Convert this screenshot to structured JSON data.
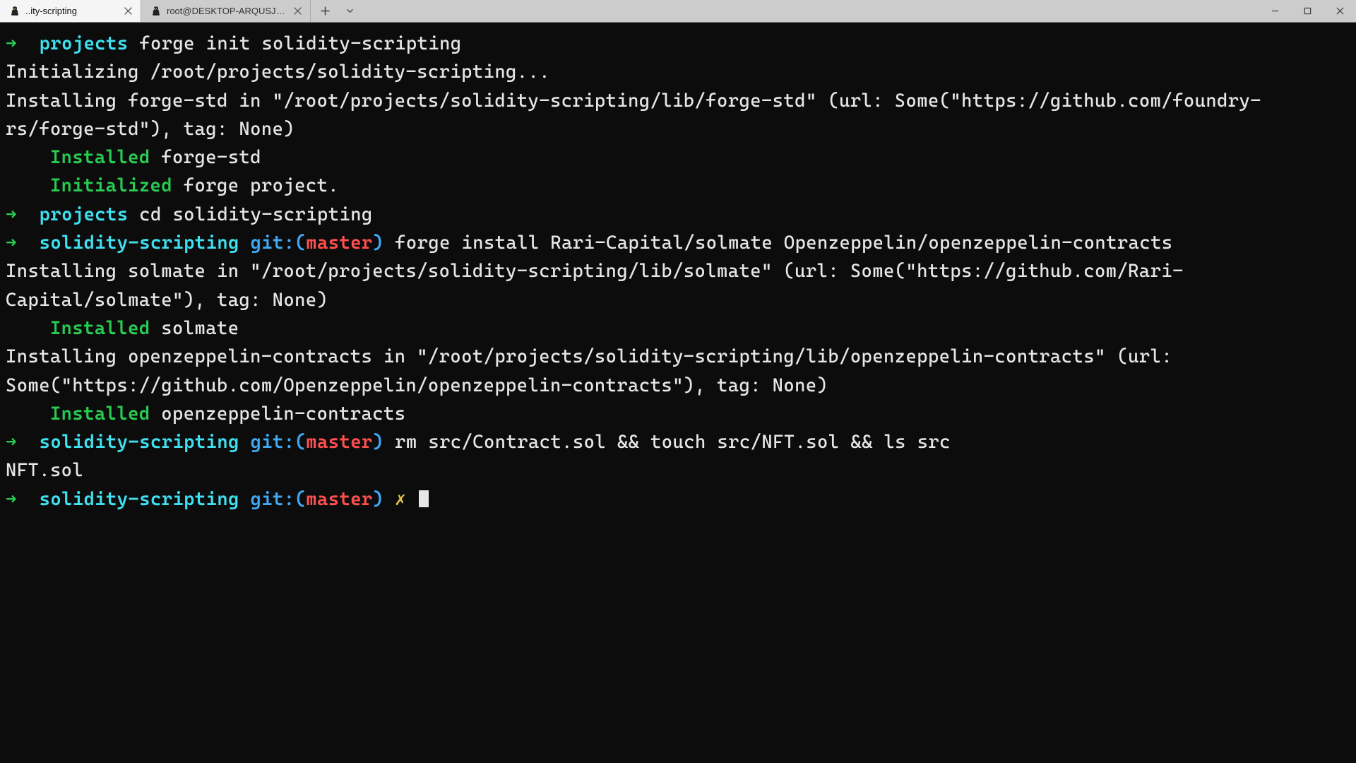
{
  "tabs": [
    {
      "title": "..ity-scripting",
      "active": true
    },
    {
      "title": "root@DESKTOP-ARQUSJA: ~/p",
      "active": false
    }
  ],
  "colors": {
    "arrow": "#29cc52",
    "cyan": "#3fe0ef",
    "blue": "#3fa9f5",
    "red": "#ff4f4f",
    "green": "#29cc52",
    "yellow": "#e6c34a"
  },
  "terminal": {
    "lines": [
      {
        "segments": [
          {
            "class": "c-arrow",
            "text": "➜  "
          },
          {
            "class": "c-cyan",
            "text": "projects"
          },
          {
            "class": "c-plain",
            "text": " forge init solidity-scripting"
          }
        ]
      },
      {
        "segments": [
          {
            "class": "c-plain",
            "text": "Initializing /root/projects/solidity-scripting..."
          }
        ]
      },
      {
        "segments": [
          {
            "class": "c-plain",
            "text": "Installing forge-std in \"/root/projects/solidity-scripting/lib/forge-std\" (url: Some(\"https://github.com/foundry-rs/forge-std\"), tag: None)"
          }
        ]
      },
      {
        "segments": [
          {
            "class": "c-plain",
            "text": "    "
          },
          {
            "class": "c-green",
            "text": "Installed"
          },
          {
            "class": "c-plain",
            "text": " forge-std"
          }
        ]
      },
      {
        "segments": [
          {
            "class": "c-plain",
            "text": "    "
          },
          {
            "class": "c-green",
            "text": "Initialized"
          },
          {
            "class": "c-plain",
            "text": " forge project."
          }
        ]
      },
      {
        "segments": [
          {
            "class": "c-arrow",
            "text": "➜  "
          },
          {
            "class": "c-cyan",
            "text": "projects"
          },
          {
            "class": "c-plain",
            "text": " cd solidity-scripting"
          }
        ]
      },
      {
        "segments": [
          {
            "class": "c-arrow",
            "text": "➜  "
          },
          {
            "class": "c-cyan",
            "text": "solidity-scripting"
          },
          {
            "class": "c-plain",
            "text": " "
          },
          {
            "class": "c-blue",
            "text": "git:("
          },
          {
            "class": "c-red",
            "text": "master"
          },
          {
            "class": "c-blue",
            "text": ")"
          },
          {
            "class": "c-plain",
            "text": " forge install Rari-Capital/solmate Openzeppelin/openzeppelin-contracts"
          }
        ]
      },
      {
        "segments": [
          {
            "class": "c-plain",
            "text": "Installing solmate in \"/root/projects/solidity-scripting/lib/solmate\" (url: Some(\"https://github.com/Rari-Capital/solmate\"), tag: None)"
          }
        ]
      },
      {
        "segments": [
          {
            "class": "c-plain",
            "text": "    "
          },
          {
            "class": "c-green",
            "text": "Installed"
          },
          {
            "class": "c-plain",
            "text": " solmate"
          }
        ]
      },
      {
        "segments": [
          {
            "class": "c-plain",
            "text": "Installing openzeppelin-contracts in \"/root/projects/solidity-scripting/lib/openzeppelin-contracts\" (url: Some(\"https://github.com/Openzeppelin/openzeppelin-contracts\"), tag: None)"
          }
        ]
      },
      {
        "segments": [
          {
            "class": "c-plain",
            "text": "    "
          },
          {
            "class": "c-green",
            "text": "Installed"
          },
          {
            "class": "c-plain",
            "text": " openzeppelin-contracts"
          }
        ]
      },
      {
        "segments": [
          {
            "class": "c-arrow",
            "text": "➜  "
          },
          {
            "class": "c-cyan",
            "text": "solidity-scripting"
          },
          {
            "class": "c-plain",
            "text": " "
          },
          {
            "class": "c-blue",
            "text": "git:("
          },
          {
            "class": "c-red",
            "text": "master"
          },
          {
            "class": "c-blue",
            "text": ")"
          },
          {
            "class": "c-plain",
            "text": " rm src/Contract.sol && touch src/NFT.sol && ls src"
          }
        ]
      },
      {
        "segments": [
          {
            "class": "c-plain",
            "text": "NFT.sol"
          }
        ]
      },
      {
        "segments": [
          {
            "class": "c-arrow",
            "text": "➜  "
          },
          {
            "class": "c-cyan",
            "text": "solidity-scripting"
          },
          {
            "class": "c-plain",
            "text": " "
          },
          {
            "class": "c-blue",
            "text": "git:("
          },
          {
            "class": "c-red",
            "text": "master"
          },
          {
            "class": "c-blue",
            "text": ")"
          },
          {
            "class": "c-plain",
            "text": " "
          },
          {
            "class": "c-yellow",
            "text": "✗"
          },
          {
            "class": "c-plain",
            "text": " "
          },
          {
            "class": "cursor",
            "text": ""
          }
        ]
      }
    ]
  }
}
